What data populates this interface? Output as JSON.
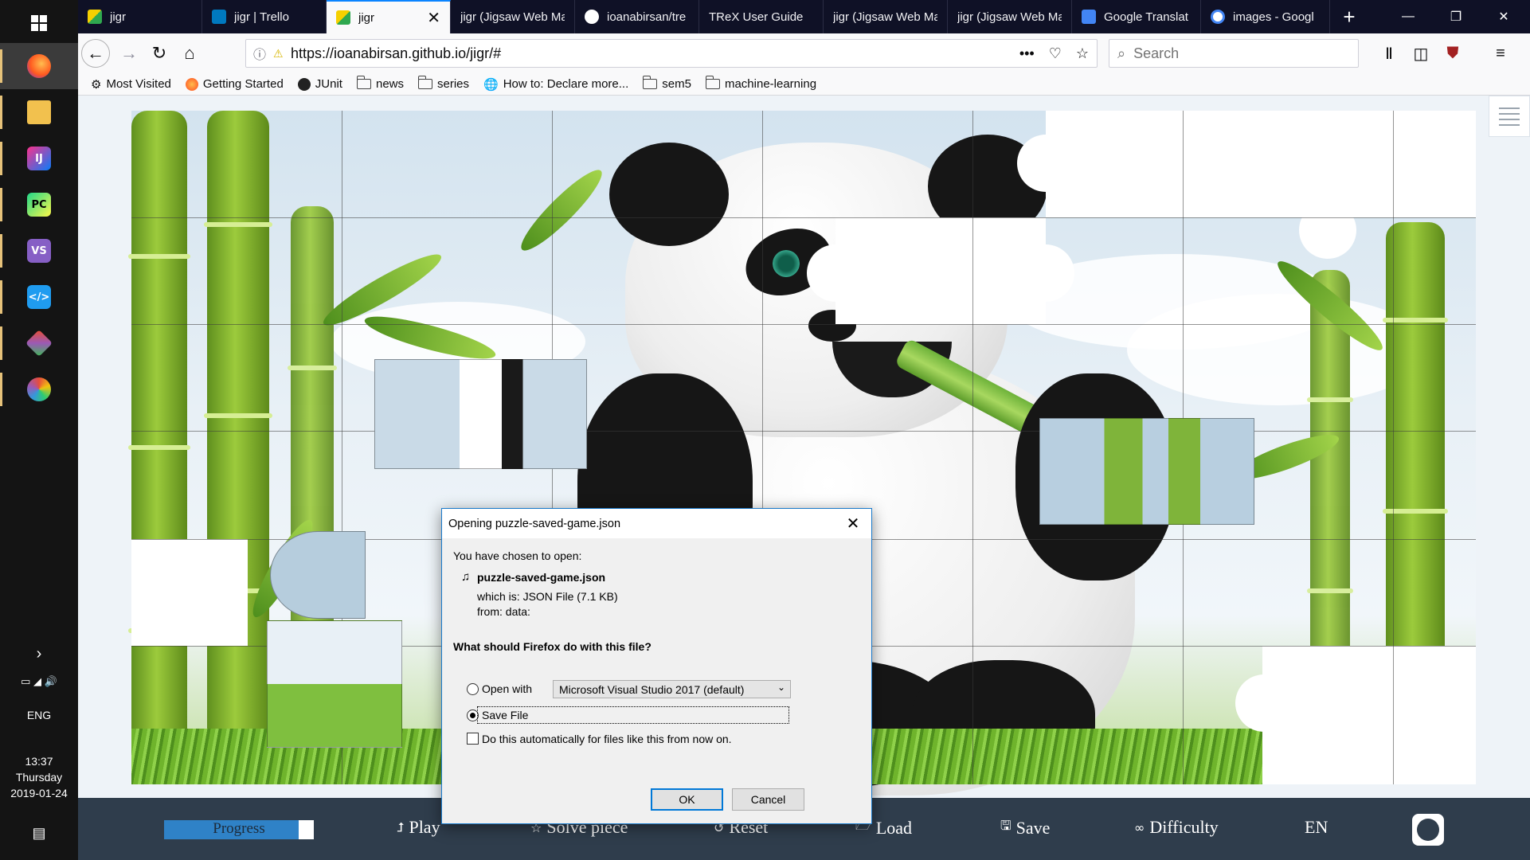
{
  "taskbar": {
    "tray": {
      "language": "ENG",
      "time": "13:37",
      "day": "Thursday",
      "date": "2019-01-24"
    }
  },
  "browser": {
    "tabs": [
      {
        "title": "jigr"
      },
      {
        "title": "jigr | Trello"
      },
      {
        "title": "jigr"
      },
      {
        "title": "jigr (Jigsaw Web Ma"
      },
      {
        "title": "ioanabirsan/tre"
      },
      {
        "title": "TReX User Guide"
      },
      {
        "title": "jigr (Jigsaw Web Ma"
      },
      {
        "title": "jigr (Jigsaw Web Ma"
      },
      {
        "title": "Google Translat"
      },
      {
        "title": "images - Googl"
      }
    ],
    "url": "https://ioanabirsan.github.io/jigr/#",
    "search_placeholder": "Search",
    "bookmarks": [
      {
        "label": "Most Visited"
      },
      {
        "label": "Getting Started"
      },
      {
        "label": "JUnit"
      },
      {
        "label": "news"
      },
      {
        "label": "series"
      },
      {
        "label": "How to: Declare more..."
      },
      {
        "label": "sem5"
      },
      {
        "label": "machine-learning"
      }
    ]
  },
  "game": {
    "progress_label": "Progress",
    "progress_value": 0.9,
    "controls": {
      "play": "Play",
      "solve_piece": "Solve piece",
      "reset": "Reset",
      "load": "Load",
      "save": "Save",
      "difficulty": "Difficulty",
      "language": "EN"
    }
  },
  "dialog": {
    "title": "Opening puzzle-saved-game.json",
    "chosen_text": "You have chosen to open:",
    "file_name": "puzzle-saved-game.json",
    "which_is": "which is:  JSON File (7.1 KB)",
    "from": "from:  data:",
    "question": "What should Firefox do with this file?",
    "open_with_label": "Open with",
    "open_with_app": "Microsoft Visual Studio 2017 (default)",
    "save_file_label": "Save File",
    "auto_label": "Do this automatically for files like this from now on.",
    "ok": "OK",
    "cancel": "Cancel"
  },
  "colors": {
    "tabstrip": "#0f1126",
    "controls_bar": "#2f3d4c",
    "progress_fill": "#2f82c7",
    "dialog_border": "#1979ca"
  }
}
